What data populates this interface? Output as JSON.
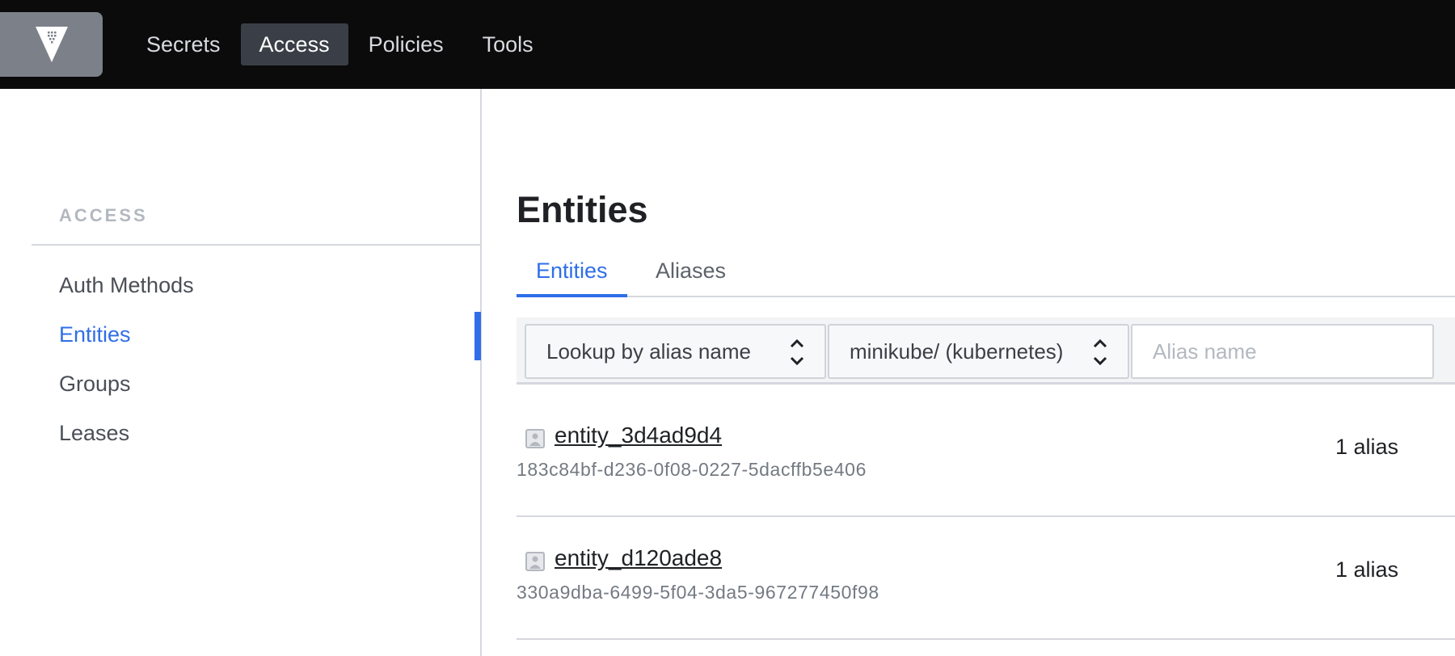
{
  "topnav": {
    "logo": "vault-logo-icon",
    "items": [
      {
        "label": "Secrets",
        "active": false
      },
      {
        "label": "Access",
        "active": true
      },
      {
        "label": "Policies",
        "active": false
      },
      {
        "label": "Tools",
        "active": false
      }
    ]
  },
  "sidebar": {
    "heading": "ACCESS",
    "items": [
      {
        "label": "Auth Methods",
        "active": false
      },
      {
        "label": "Entities",
        "active": true
      },
      {
        "label": "Groups",
        "active": false
      },
      {
        "label": "Leases",
        "active": false
      }
    ]
  },
  "main": {
    "title": "Entities",
    "tabs": [
      {
        "label": "Entities",
        "active": true
      },
      {
        "label": "Aliases",
        "active": false
      }
    ],
    "filters": {
      "lookup_select": "Lookup by alias name",
      "mount_select": "minikube/ (kubernetes)",
      "alias_input_value": "",
      "alias_input_placeholder": "Alias name"
    },
    "entities": [
      {
        "icon": "user-square-icon",
        "name": "entity_3d4ad9d4",
        "id": "183c84bf-d236-0f08-0227-5dacffb5e406",
        "aliases": "1 alias"
      },
      {
        "icon": "user-square-icon",
        "name": "entity_d120ade8",
        "id": "330a9dba-6499-5f04-3da5-967277450f98",
        "aliases": "1 alias"
      }
    ]
  },
  "colors": {
    "accent": "#2f6ee8",
    "topbar": "#0b0b0c",
    "nav_active_bg": "#3a3f47"
  }
}
